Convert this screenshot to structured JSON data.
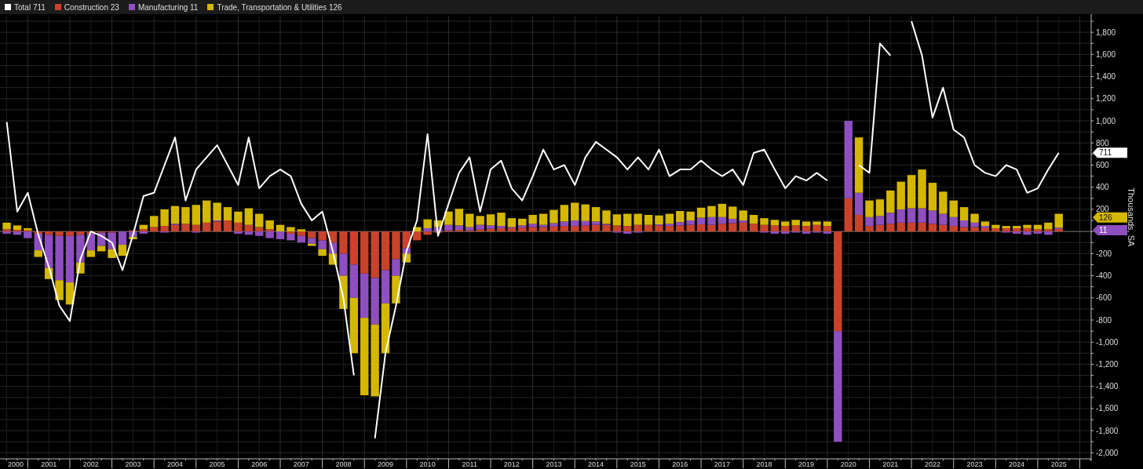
{
  "legend": [
    {
      "value": "711",
      "color": "#ffffff"
    },
    {
      "value": "23",
      "color": "#c8432a"
    },
    {
      "value": "11",
      "color": "#8e4fc0"
    },
    {
      "value": "126",
      "color": "#d4b800"
    }
  ],
  "value_tags": [
    {
      "text": "711",
      "color": "#ffffff"
    },
    {
      "text": "126",
      "color": "#d4b800"
    },
    {
      "text": "11",
      "color": "#8e4fc0"
    }
  ],
  "bar_chart": {
    "chart_data": {
      "type": "bar",
      "stacked": true,
      "grid": true,
      "ylabel": "Thousands, SA",
      "xlim": [
        2000.34,
        2026.27
      ],
      "ylim": [
        -2040,
        1950
      ],
      "yticks": [
        {
          "value": -2000,
          "label": "-2,000"
        },
        {
          "value": -1800,
          "label": "-1,800"
        },
        {
          "value": -1600,
          "label": "-1,600"
        },
        {
          "value": -1400,
          "label": "-1,400"
        },
        {
          "value": -1200,
          "label": "-1,200"
        },
        {
          "value": -1000,
          "label": "-1,000"
        },
        -800,
        -600,
        -400,
        -200,
        200,
        400,
        600,
        800,
        {
          "value": 1000,
          "label": "1,000"
        },
        {
          "value": 1200,
          "label": "1,200"
        },
        {
          "value": 1400,
          "label": "1,400"
        },
        {
          "value": 1600,
          "label": "1,600"
        },
        {
          "value": 1800,
          "label": "1,800"
        }
      ],
      "xticks": [
        {
          "value": 2000.5,
          "label": "2000"
        },
        {
          "value": 2001.5,
          "label": "2001"
        },
        {
          "value": 2002.5,
          "label": "2002"
        },
        {
          "value": 2003.5,
          "label": "2003"
        },
        {
          "value": 2004.5,
          "label": "2004"
        },
        {
          "value": 2005.5,
          "label": "2005"
        },
        {
          "value": 2006.5,
          "label": "2006"
        },
        {
          "value": 2007.5,
          "label": "2007"
        },
        {
          "value": 2008.5,
          "label": "2008"
        },
        {
          "value": 2009.5,
          "label": "2009"
        },
        {
          "value": 2010.5,
          "label": "2010"
        },
        {
          "value": 2011.5,
          "label": "2011"
        },
        {
          "value": 2012.5,
          "label": "2012"
        },
        {
          "value": 2013.5,
          "label": "2013"
        },
        {
          "value": 2014.5,
          "label": "2014"
        },
        {
          "value": 2015.5,
          "label": "2015"
        },
        {
          "value": 2016.5,
          "label": "2016"
        },
        {
          "value": 2017.5,
          "label": "2017"
        },
        {
          "value": 2018.5,
          "label": "2018"
        },
        {
          "value": 2019.5,
          "label": "2019"
        },
        {
          "value": 2020.5,
          "label": "2020"
        },
        {
          "value": 2021.5,
          "label": "2021"
        },
        {
          "value": 2022.5,
          "label": "2022"
        },
        {
          "value": 2023.5,
          "label": "2023"
        },
        {
          "value": 2024.5,
          "label": "2024"
        },
        {
          "value": 2025.5,
          "label": "2025"
        }
      ],
      "x": [
        2000.5,
        2000.75,
        2001,
        2001.25,
        2001.5,
        2001.75,
        2002,
        2002.25,
        2002.5,
        2002.75,
        2003,
        2003.25,
        2003.5,
        2003.75,
        2004,
        2004.25,
        2004.5,
        2004.75,
        2005,
        2005.25,
        2005.5,
        2005.75,
        2006,
        2006.25,
        2006.5,
        2006.75,
        2007,
        2007.25,
        2007.5,
        2007.75,
        2008,
        2008.25,
        2008.5,
        2008.75,
        2009,
        2009.25,
        2009.5,
        2009.75,
        2010,
        2010.25,
        2010.5,
        2010.75,
        2011,
        2011.25,
        2011.5,
        2011.75,
        2012,
        2012.25,
        2012.5,
        2012.75,
        2013,
        2013.25,
        2013.5,
        2013.75,
        2014,
        2014.25,
        2014.5,
        2014.75,
        2015,
        2015.25,
        2015.5,
        2015.75,
        2016,
        2016.25,
        2016.5,
        2016.75,
        2017,
        2017.25,
        2017.5,
        2017.75,
        2018,
        2018.25,
        2018.5,
        2018.75,
        2019,
        2019.25,
        2019.5,
        2019.75,
        2020,
        2020.25,
        2020.5,
        2020.75,
        2021,
        2021.25,
        2021.5,
        2021.75,
        2022,
        2022.25,
        2022.5,
        2022.75,
        2023,
        2023.25,
        2023.5,
        2023.75,
        2024,
        2024.25,
        2024.5,
        2024.75,
        2025,
        2025.25,
        2025.5
      ],
      "series": [
        {
          "name": "Construction",
          "color": "#c8432a",
          "values": [
            20,
            15,
            10,
            -20,
            -30,
            -40,
            -40,
            -30,
            -20,
            -10,
            -10,
            0,
            10,
            20,
            40,
            50,
            60,
            70,
            60,
            80,
            90,
            100,
            80,
            60,
            40,
            20,
            0,
            -20,
            -40,
            -60,
            -80,
            -100,
            -200,
            -300,
            -380,
            -420,
            -350,
            -250,
            -150,
            -80,
            -30,
            -10,
            10,
            15,
            10,
            20,
            25,
            30,
            30,
            35,
            40,
            40,
            45,
            50,
            50,
            55,
            60,
            60,
            55,
            50,
            60,
            60,
            55,
            50,
            55,
            60,
            65,
            60,
            70,
            75,
            80,
            70,
            60,
            55,
            50,
            55,
            50,
            60,
            50,
            -900,
            300,
            150,
            50,
            60,
            70,
            80,
            80,
            80,
            70,
            60,
            50,
            40,
            40,
            30,
            30,
            30,
            30,
            30,
            20,
            20,
            23
          ]
        },
        {
          "name": "Manufacturing",
          "color": "#8e4fc0",
          "values": [
            -20,
            -30,
            -60,
            -150,
            -300,
            -400,
            -420,
            -250,
            -150,
            -120,
            -150,
            -120,
            -50,
            -20,
            0,
            -10,
            10,
            0,
            -10,
            0,
            10,
            0,
            -20,
            -30,
            -40,
            -60,
            -70,
            -60,
            -60,
            -50,
            -80,
            -100,
            -200,
            -300,
            -400,
            -420,
            -300,
            -150,
            -50,
            0,
            30,
            40,
            50,
            40,
            30,
            40,
            30,
            20,
            10,
            20,
            30,
            20,
            30,
            40,
            50,
            40,
            30,
            10,
            -10,
            -20,
            -10,
            0,
            10,
            20,
            30,
            40,
            60,
            70,
            60,
            40,
            20,
            0,
            -10,
            -20,
            -20,
            -10,
            -20,
            -10,
            -20,
            -1000,
            700,
            200,
            80,
            80,
            100,
            120,
            130,
            130,
            120,
            100,
            80,
            60,
            40,
            20,
            0,
            -10,
            -20,
            -30,
            -20,
            -30,
            11
          ]
        },
        {
          "name": "Trade, Transportation & Utilities",
          "color": "#d4b800",
          "values": [
            60,
            40,
            20,
            -60,
            -100,
            -180,
            -200,
            -100,
            -60,
            -50,
            -80,
            -100,
            -20,
            40,
            100,
            150,
            160,
            150,
            180,
            200,
            160,
            120,
            100,
            150,
            120,
            80,
            60,
            40,
            20,
            -20,
            -60,
            -100,
            -300,
            -500,
            -700,
            -650,
            -450,
            -250,
            -80,
            40,
            80,
            60,
            120,
            150,
            120,
            80,
            100,
            120,
            80,
            60,
            80,
            100,
            120,
            150,
            160,
            150,
            130,
            120,
            100,
            110,
            100,
            90,
            80,
            90,
            100,
            80,
            90,
            100,
            120,
            110,
            90,
            80,
            60,
            50,
            40,
            50,
            40,
            30,
            40,
            null,
            null,
            500,
            150,
            150,
            200,
            250,
            300,
            350,
            250,
            200,
            150,
            120,
            80,
            40,
            30,
            20,
            20,
            30,
            40,
            60,
            126
          ]
        },
        {
          "name": "Total",
          "type": "line",
          "color": "#ffffff",
          "values": [
            990,
            180,
            350,
            -30,
            -320,
            -670,
            -810,
            -250,
            0,
            -40,
            -100,
            -350,
            -30,
            320,
            350,
            600,
            850,
            280,
            560,
            670,
            780,
            600,
            420,
            850,
            390,
            500,
            560,
            500,
            250,
            100,
            180,
            -180,
            -600,
            -1300,
            null,
            -1870,
            -1100,
            -670,
            -180,
            100,
            880,
            -40,
            250,
            530,
            670,
            180,
            560,
            640,
            390,
            280,
            500,
            740,
            560,
            600,
            420,
            670,
            810,
            740,
            670,
            560,
            670,
            560,
            740,
            500,
            560,
            560,
            640,
            560,
            500,
            560,
            420,
            710,
            740,
            560,
            390,
            500,
            460,
            530,
            460,
            null,
            null,
            600,
            530,
            1700,
            1590,
            null,
            1900,
            1590,
            1030,
            1300,
            920,
            850,
            600,
            530,
            500,
            600,
            560,
            350,
            390,
            560,
            711
          ]
        }
      ]
    }
  }
}
